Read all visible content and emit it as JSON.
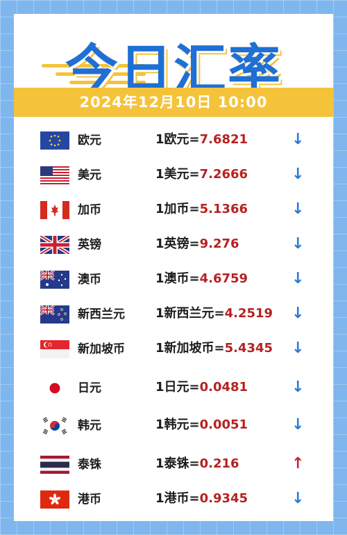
{
  "title": "今日汇率",
  "date_line": "2024年12月10日   10:00",
  "colors": {
    "down": "#2b7bd6",
    "up": "#c0272d",
    "accent": "#f4c33a",
    "title": "#1f6fd4"
  },
  "rows": [
    {
      "flag_icon": "eu-flag-icon",
      "name": "欧元",
      "rate_label": "1欧元=",
      "rate_value": "7.6821",
      "trend": "↓",
      "trend_dir": "down"
    },
    {
      "flag_icon": "us-flag-icon",
      "name": "美元",
      "rate_label": "1美元=",
      "rate_value": "7.2666",
      "trend": "↓",
      "trend_dir": "down"
    },
    {
      "flag_icon": "ca-flag-icon",
      "name": "加币",
      "rate_label": "1加币=",
      "rate_value": "5.1366",
      "trend": "↓",
      "trend_dir": "down"
    },
    {
      "flag_icon": "uk-flag-icon",
      "name": "英镑",
      "rate_label": "1英镑=",
      "rate_value": "9.276",
      "trend": "↓",
      "trend_dir": "down"
    },
    {
      "flag_icon": "au-flag-icon",
      "name": "澳币",
      "rate_label": "1澳币=",
      "rate_value": "4.6759",
      "trend": "↓",
      "trend_dir": "down"
    },
    {
      "flag_icon": "nz-flag-icon",
      "name": "新西兰元",
      "rate_label": "1新西兰元=",
      "rate_value": "4.2519",
      "trend": "↓",
      "trend_dir": "down"
    },
    {
      "flag_icon": "sg-flag-icon",
      "name": "新加坡币",
      "rate_label": "1新加坡币=",
      "rate_value": "5.4345",
      "trend": "↓",
      "trend_dir": "down"
    },
    {
      "flag_icon": "jp-flag-icon",
      "name": "日元",
      "rate_label": "1日元=",
      "rate_value": "0.0481",
      "trend": "↓",
      "trend_dir": "down"
    },
    {
      "flag_icon": "kr-flag-icon",
      "name": "韩元",
      "rate_label": "1韩元=",
      "rate_value": "0.0051",
      "trend": "↓",
      "trend_dir": "down"
    },
    {
      "flag_icon": "th-flag-icon",
      "name": "泰铢",
      "rate_label": "1泰铢=",
      "rate_value": "0.216",
      "trend": "↑",
      "trend_dir": "up"
    },
    {
      "flag_icon": "hk-flag-icon",
      "name": "港币",
      "rate_label": "1港币=",
      "rate_value": "0.9345",
      "trend": "↓",
      "trend_dir": "down"
    }
  ]
}
